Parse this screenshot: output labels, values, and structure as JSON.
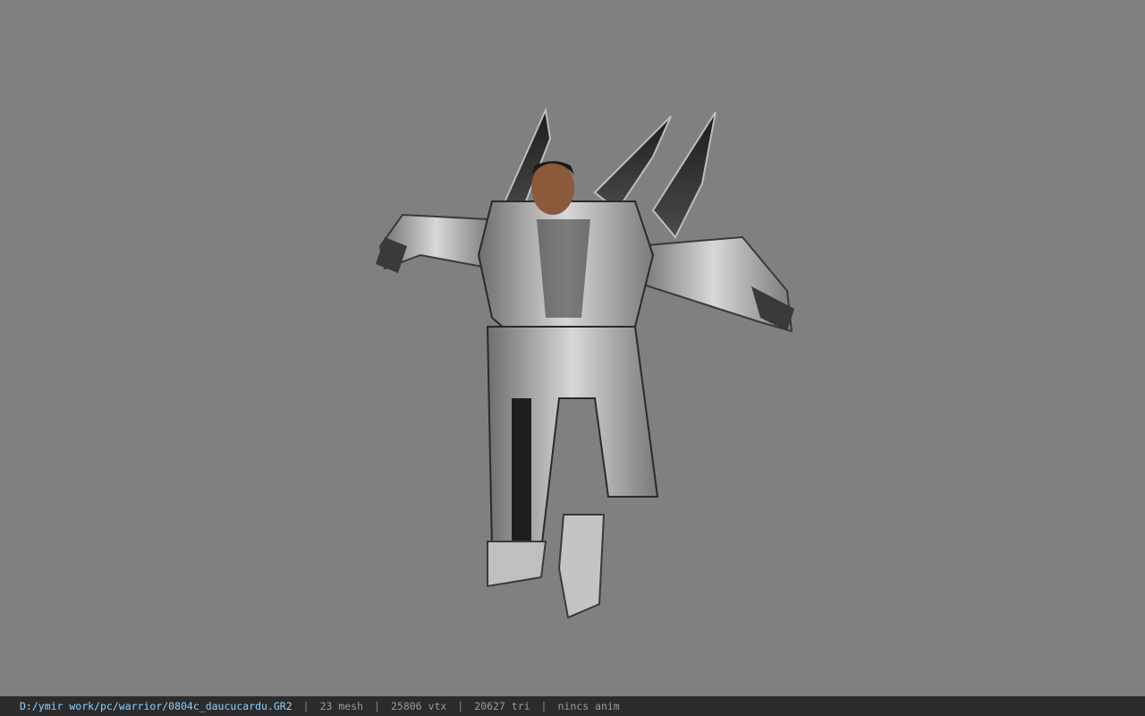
{
  "viewport": {
    "background_color": "#808080",
    "model_description_icon": "armored-warrior-model"
  },
  "statusbar": {
    "file_path": "D:/ymir work/pc/warrior/0804c_daucucardu.GR2",
    "mesh_count": "23 mesh",
    "vertex_count": "25806 vtx",
    "triangle_count": "20627 tri",
    "animation": "nincs anim",
    "separator": "|"
  },
  "colors": {
    "statusbar_bg": "#2b2b2b",
    "path_color": "#8fd0ff",
    "stat_color": "#9a9a9a"
  }
}
